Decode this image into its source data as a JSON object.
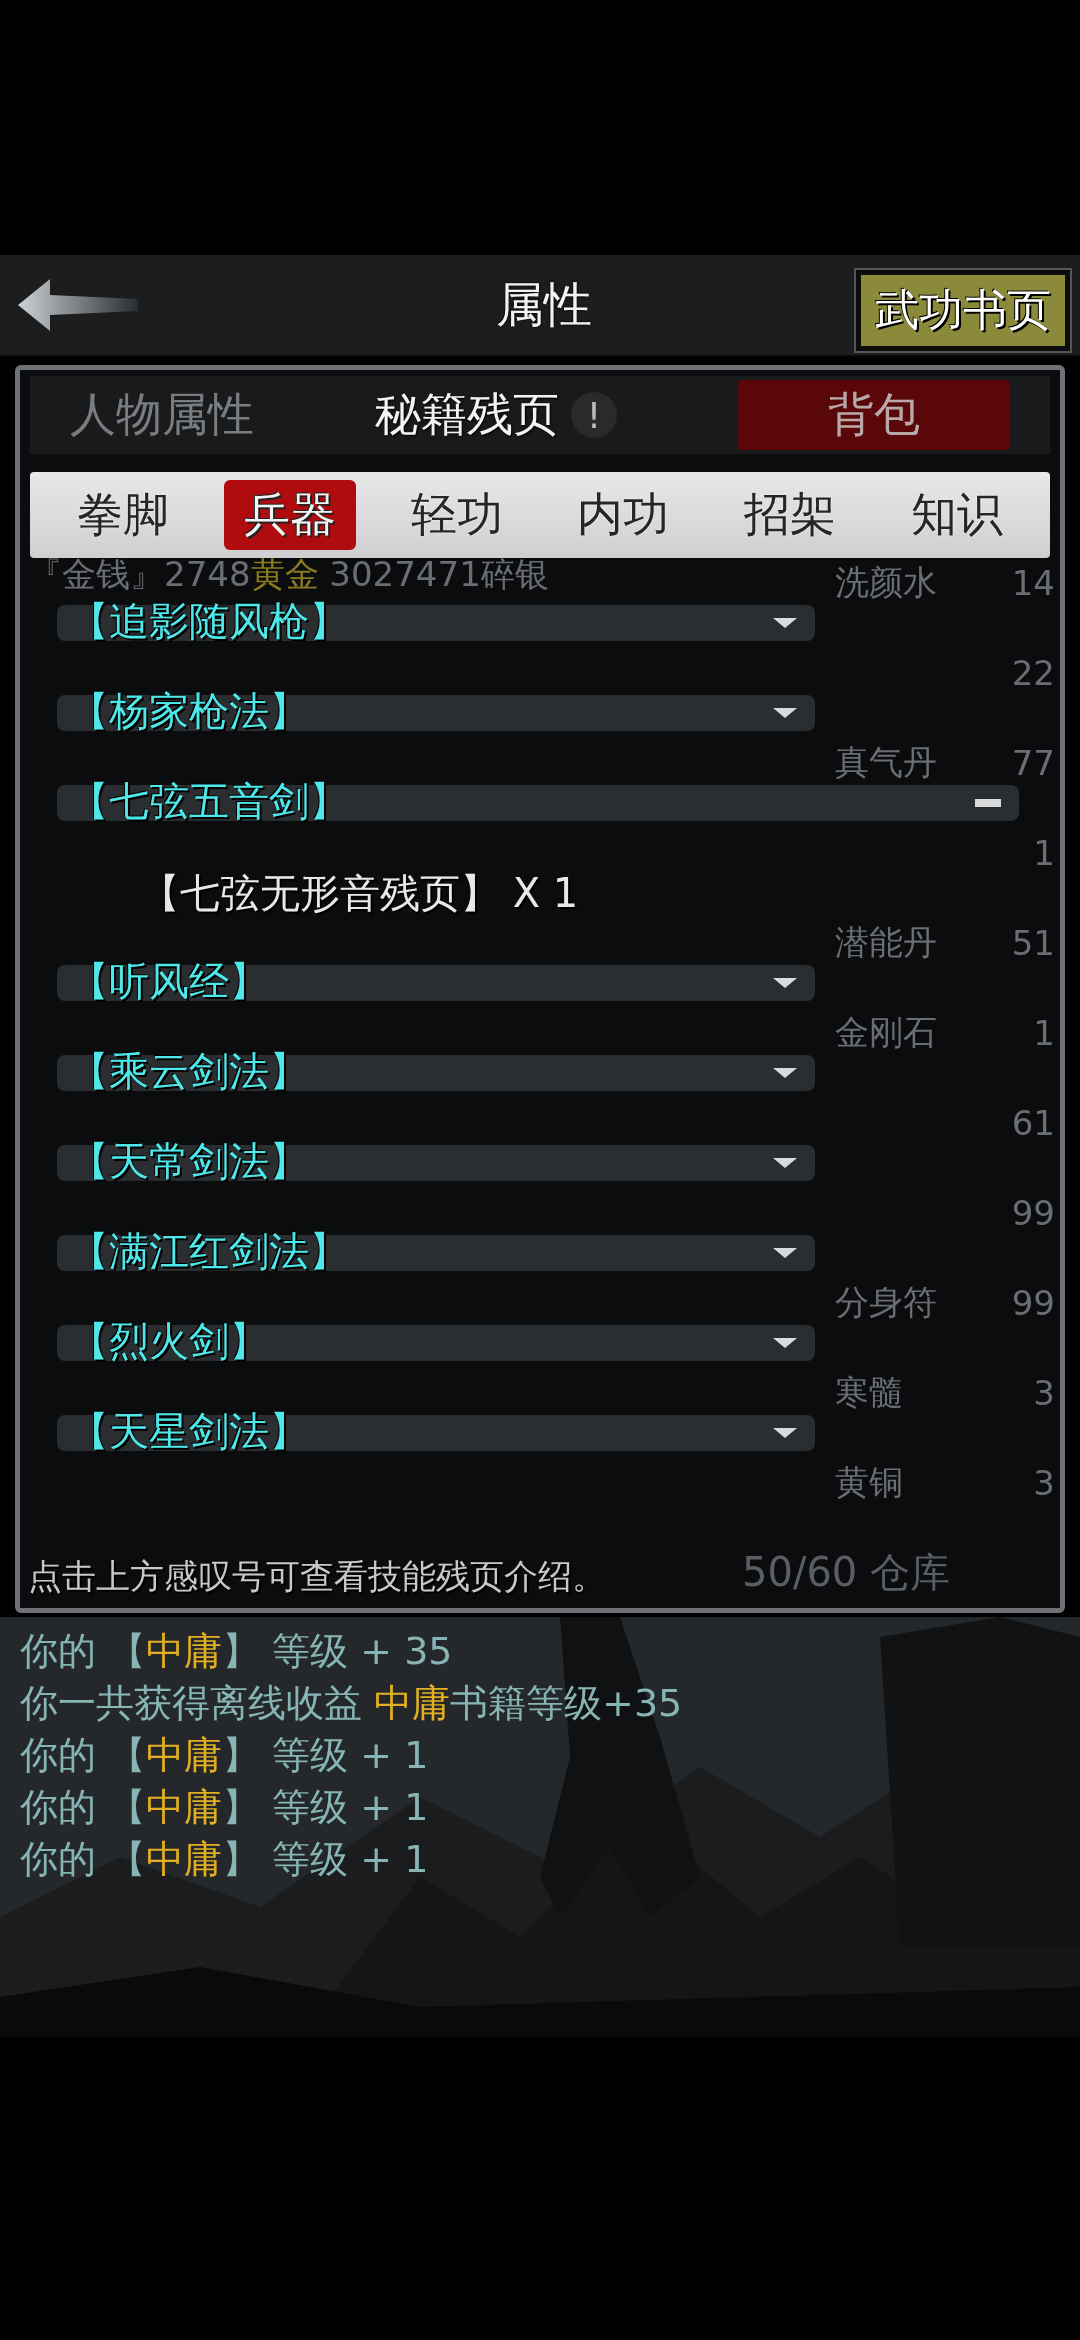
{
  "header": {
    "title": "属性",
    "action": "武功书页"
  },
  "panel_tabs": [
    {
      "label": "人物属性",
      "selected": false,
      "kind": "plain"
    },
    {
      "label": "秘籍残页",
      "selected": true,
      "kind": "info"
    },
    {
      "label": "背包",
      "selected": false,
      "kind": "red"
    }
  ],
  "info_mark": "!",
  "tabs": [
    {
      "label": "拳脚",
      "selected": false
    },
    {
      "label": "兵器",
      "selected": true
    },
    {
      "label": "轻功",
      "selected": false
    },
    {
      "label": "内功",
      "selected": false
    },
    {
      "label": "招架",
      "selected": false
    },
    {
      "label": "知识",
      "selected": false
    }
  ],
  "background_inventory": {
    "money": [
      {
        "text": "『金钱』2748",
        "gold": false
      },
      {
        "text": "黄金",
        "gold": true
      },
      {
        "text": " 3027471碎银",
        "gold": false
      }
    ],
    "items": [
      {
        "name": "洗颜水",
        "count": "14"
      },
      {
        "count": "22"
      },
      {
        "name": "真气丹",
        "count": "77"
      },
      {
        "count": "1"
      },
      {
        "name": "潜能丹",
        "count": "51"
      },
      {
        "name": "金刚石",
        "count": "1"
      },
      {
        "count": "61"
      },
      {
        "count": "99"
      },
      {
        "name": "分身符",
        "count": "99"
      },
      {
        "name": "寒髓",
        "count": "3"
      },
      {
        "name": "黄铜",
        "count": "3"
      }
    ],
    "capacity": "50/60 仓库"
  },
  "skills": [
    {
      "name": "【追影随风枪】",
      "expanded": false
    },
    {
      "name": "【杨家枪法】",
      "expanded": false
    },
    {
      "name": "【七弦五音剑】",
      "expanded": true,
      "pages": [
        "【七弦无形音残页】 X 1"
      ]
    },
    {
      "name": "【听风经】",
      "expanded": false
    },
    {
      "name": "【乘云剑法】",
      "expanded": false
    },
    {
      "name": "【天常剑法】",
      "expanded": false
    },
    {
      "name": "【满江红剑法】",
      "expanded": false
    },
    {
      "name": "【烈火剑】",
      "expanded": false
    },
    {
      "name": "【天星剑法】",
      "expanded": false
    }
  ],
  "hint": "点击上方感叹号可查看技能残页介绍。",
  "log": [
    [
      {
        "text": "你的 【",
        "hl": false
      },
      {
        "text": "中庸",
        "hl": true
      },
      {
        "text": "】 等级 + 35",
        "hl": false
      }
    ],
    [
      {
        "text": "你一共获得离线收益 ",
        "hl": false
      },
      {
        "text": "中庸",
        "hl": true
      },
      {
        "text": "书籍等级+35",
        "hl": false
      }
    ],
    [
      {
        "text": "你的 【",
        "hl": false
      },
      {
        "text": "中庸",
        "hl": true
      },
      {
        "text": "】 等级 + 1",
        "hl": false
      }
    ],
    [
      {
        "text": "你的 【",
        "hl": false
      },
      {
        "text": "中庸",
        "hl": true
      },
      {
        "text": "】 等级 + 1",
        "hl": false
      }
    ],
    [
      {
        "text": "你的 【",
        "hl": false
      },
      {
        "text": "中庸",
        "hl": true
      },
      {
        "text": "】 等级 + 1",
        "hl": false
      }
    ]
  ]
}
